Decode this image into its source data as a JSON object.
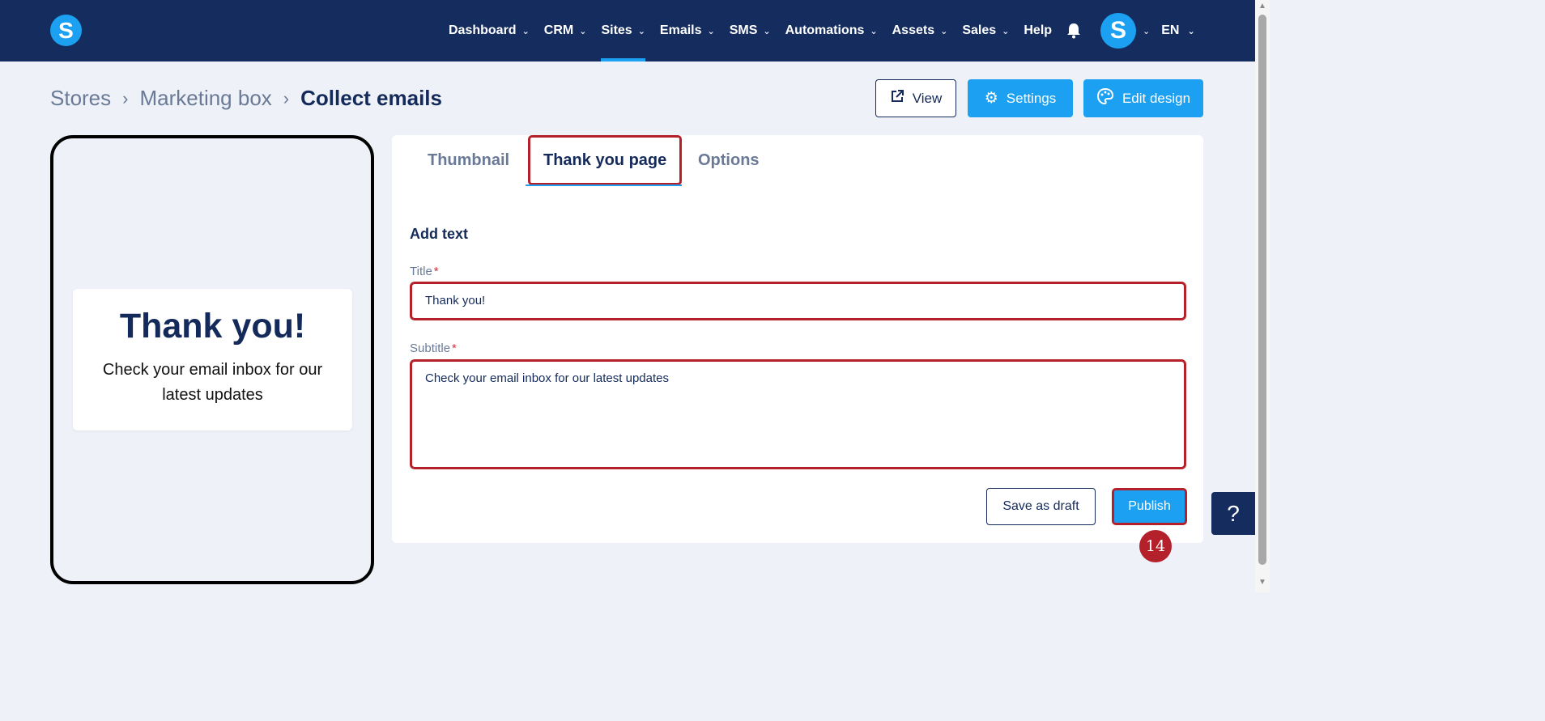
{
  "nav": {
    "logo_letter": "S",
    "items": [
      {
        "label": "Dashboard",
        "has_dropdown": true,
        "active": false
      },
      {
        "label": "CRM",
        "has_dropdown": true,
        "active": false
      },
      {
        "label": "Sites",
        "has_dropdown": true,
        "active": true
      },
      {
        "label": "Emails",
        "has_dropdown": true,
        "active": false
      },
      {
        "label": "SMS",
        "has_dropdown": true,
        "active": false
      },
      {
        "label": "Automations",
        "has_dropdown": true,
        "active": false
      },
      {
        "label": "Assets",
        "has_dropdown": true,
        "active": false
      },
      {
        "label": "Sales",
        "has_dropdown": true,
        "active": false
      },
      {
        "label": "Help",
        "has_dropdown": false,
        "active": false
      }
    ],
    "avatar_letter": "S",
    "language": "EN",
    "icons": {
      "notifications": "bell-icon",
      "dropdown": "chevron-down-icon"
    }
  },
  "breadcrumb": {
    "items": [
      "Stores",
      "Marketing box"
    ],
    "current": "Collect emails"
  },
  "actions": {
    "view_label": "View",
    "settings_label": "Settings",
    "edit_design_label": "Edit design"
  },
  "preview": {
    "title": "Thank you!",
    "subtitle": "Check your email inbox for our latest updates"
  },
  "tabs": {
    "thumbnail": "Thumbnail",
    "thank_you": "Thank you page",
    "options": "Options",
    "active": "Thank you page"
  },
  "form": {
    "section_title": "Add text",
    "title_label": "Title",
    "title_value": "Thank you!",
    "subtitle_label": "Subtitle",
    "subtitle_value": "Check your email inbox for our latest updates",
    "required_mark": "*",
    "save_draft_label": "Save as draft",
    "publish_label": "Publish"
  },
  "step_badge": "14",
  "help_label": "?",
  "colors": {
    "nav_bg": "#152d5e",
    "accent": "#1ba0f2",
    "highlight": "#b4212a",
    "page_bg": "#eef2f8"
  }
}
